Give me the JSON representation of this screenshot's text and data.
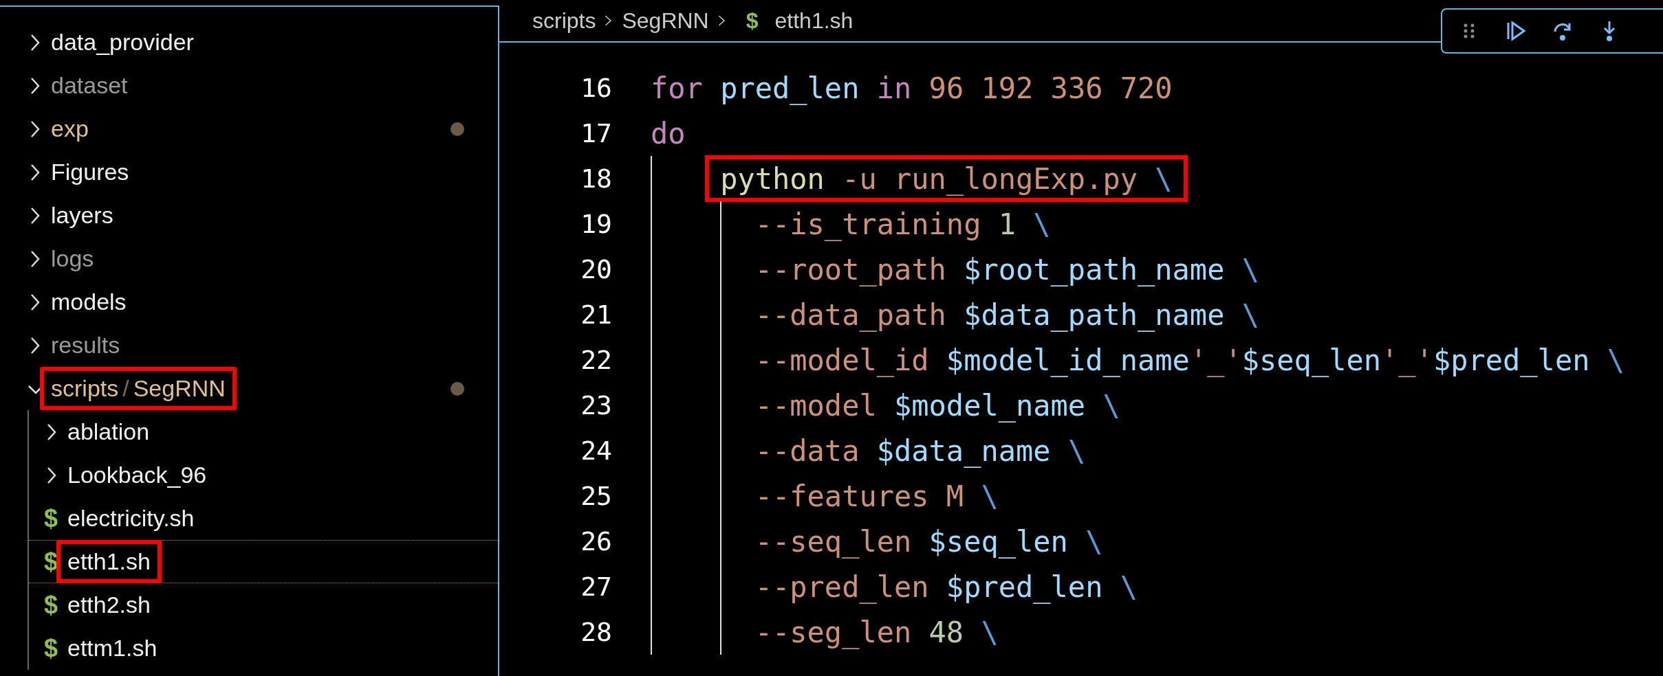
{
  "explorer": {
    "items": [
      {
        "kind": "folder",
        "label_parts": [
          "data_provider"
        ],
        "ignored": false,
        "expanded": false,
        "modified": false,
        "selected": false,
        "highlighted": false
      },
      {
        "kind": "folder",
        "label_parts": [
          "dataset"
        ],
        "ignored": true,
        "expanded": false,
        "modified": false,
        "selected": false,
        "highlighted": false
      },
      {
        "kind": "folder",
        "label_parts": [
          "exp"
        ],
        "ignored": false,
        "expanded": false,
        "modified": true,
        "selected": false,
        "highlighted": false
      },
      {
        "kind": "folder",
        "label_parts": [
          "Figures"
        ],
        "ignored": false,
        "expanded": false,
        "modified": false,
        "selected": false,
        "highlighted": false
      },
      {
        "kind": "folder",
        "label_parts": [
          "layers"
        ],
        "ignored": false,
        "expanded": false,
        "modified": false,
        "selected": false,
        "highlighted": false
      },
      {
        "kind": "folder",
        "label_parts": [
          "logs"
        ],
        "ignored": true,
        "expanded": false,
        "modified": false,
        "selected": false,
        "highlighted": false
      },
      {
        "kind": "folder",
        "label_parts": [
          "models"
        ],
        "ignored": false,
        "expanded": false,
        "modified": false,
        "selected": false,
        "highlighted": false
      },
      {
        "kind": "folder",
        "label_parts": [
          "results"
        ],
        "ignored": true,
        "expanded": false,
        "modified": false,
        "selected": false,
        "highlighted": false
      },
      {
        "kind": "folder",
        "label_parts": [
          "scripts",
          "/",
          "SegRNN"
        ],
        "ignored": false,
        "expanded": true,
        "modified": true,
        "selected": false,
        "highlighted": true,
        "children": [
          {
            "kind": "folder",
            "label_parts": [
              "ablation"
            ],
            "ignored": false,
            "expanded": false,
            "modified": false,
            "selected": false,
            "highlighted": false
          },
          {
            "kind": "folder",
            "label_parts": [
              "Lookback_96"
            ],
            "ignored": false,
            "expanded": false,
            "modified": false,
            "selected": false,
            "highlighted": false
          },
          {
            "kind": "file",
            "icon": "$",
            "label_parts": [
              "electricity.sh"
            ],
            "ignored": false,
            "modified": false,
            "selected": false,
            "highlighted": false
          },
          {
            "kind": "file",
            "icon": "$",
            "label_parts": [
              "etth1.sh"
            ],
            "ignored": false,
            "modified": false,
            "selected": true,
            "highlighted": true
          },
          {
            "kind": "file",
            "icon": "$",
            "label_parts": [
              "etth2.sh"
            ],
            "ignored": false,
            "modified": false,
            "selected": false,
            "highlighted": false
          },
          {
            "kind": "file",
            "icon": "$",
            "label_parts": [
              "ettm1.sh"
            ],
            "ignored": false,
            "modified": false,
            "selected": false,
            "highlighted": false
          }
        ]
      }
    ]
  },
  "breadcrumb": {
    "parts": [
      "scripts",
      "SegRNN"
    ],
    "file_icon": "$",
    "file": "etth1.sh"
  },
  "editor": {
    "lines": [
      {
        "number": "16",
        "highlighted": false,
        "tokens": [
          {
            "kind": "keyword",
            "text": "for"
          },
          {
            "kind": "variable",
            "text": " pred_len "
          },
          {
            "kind": "keyword",
            "text": "in"
          },
          {
            "kind": "string",
            "text": " 96 192 336 720"
          }
        ]
      },
      {
        "number": "17",
        "highlighted": false,
        "tokens": [
          {
            "kind": "keyword",
            "text": "do"
          }
        ],
        "children": [
          {
            "number": "18",
            "highlighted": true,
            "tokens": [
              {
                "kind": "command",
                "text": "python"
              },
              {
                "kind": "string",
                "text": " -u run_longExp.py "
              },
              {
                "kind": "escape",
                "text": "\\"
              }
            ],
            "children": [
              {
                "number": "19",
                "highlighted": false,
                "tokens": [
                  {
                    "kind": "string",
                    "text": "--is_training "
                  },
                  {
                    "kind": "number",
                    "text": "1"
                  },
                  {
                    "kind": "escape",
                    "text": " \\"
                  }
                ]
              },
              {
                "number": "20",
                "highlighted": false,
                "tokens": [
                  {
                    "kind": "string",
                    "text": "--root_path "
                  },
                  {
                    "kind": "variable",
                    "text": "$root_path_name"
                  },
                  {
                    "kind": "escape",
                    "text": " \\"
                  }
                ]
              },
              {
                "number": "21",
                "highlighted": false,
                "tokens": [
                  {
                    "kind": "string",
                    "text": "--data_path "
                  },
                  {
                    "kind": "variable",
                    "text": "$data_path_name"
                  },
                  {
                    "kind": "escape",
                    "text": " \\"
                  }
                ]
              },
              {
                "number": "22",
                "highlighted": false,
                "tokens": [
                  {
                    "kind": "string",
                    "text": "--model_id "
                  },
                  {
                    "kind": "variable",
                    "text": "$model_id_name"
                  },
                  {
                    "kind": "string",
                    "text": "'_'"
                  },
                  {
                    "kind": "variable",
                    "text": "$seq_len"
                  },
                  {
                    "kind": "string",
                    "text": "'_'"
                  },
                  {
                    "kind": "variable",
                    "text": "$pred_len"
                  },
                  {
                    "kind": "escape",
                    "text": " \\"
                  }
                ]
              },
              {
                "number": "23",
                "highlighted": false,
                "tokens": [
                  {
                    "kind": "string",
                    "text": "--model "
                  },
                  {
                    "kind": "variable",
                    "text": "$model_name"
                  },
                  {
                    "kind": "escape",
                    "text": " \\"
                  }
                ]
              },
              {
                "number": "24",
                "highlighted": false,
                "tokens": [
                  {
                    "kind": "string",
                    "text": "--data "
                  },
                  {
                    "kind": "variable",
                    "text": "$data_name"
                  },
                  {
                    "kind": "escape",
                    "text": " \\"
                  }
                ]
              },
              {
                "number": "25",
                "highlighted": false,
                "tokens": [
                  {
                    "kind": "string",
                    "text": "--features M "
                  },
                  {
                    "kind": "escape",
                    "text": "\\"
                  }
                ]
              },
              {
                "number": "26",
                "highlighted": false,
                "tokens": [
                  {
                    "kind": "string",
                    "text": "--seq_len "
                  },
                  {
                    "kind": "variable",
                    "text": "$seq_len"
                  },
                  {
                    "kind": "escape",
                    "text": " \\"
                  }
                ]
              },
              {
                "number": "27",
                "highlighted": false,
                "tokens": [
                  {
                    "kind": "string",
                    "text": "--pred_len "
                  },
                  {
                    "kind": "variable",
                    "text": "$pred_len"
                  },
                  {
                    "kind": "escape",
                    "text": " \\"
                  }
                ]
              },
              {
                "number": "28",
                "highlighted": false,
                "tokens": [
                  {
                    "kind": "string",
                    "text": "--seg_len "
                  },
                  {
                    "kind": "number",
                    "text": "48"
                  },
                  {
                    "kind": "escape",
                    "text": " \\"
                  }
                ]
              }
            ]
          }
        ]
      }
    ]
  }
}
